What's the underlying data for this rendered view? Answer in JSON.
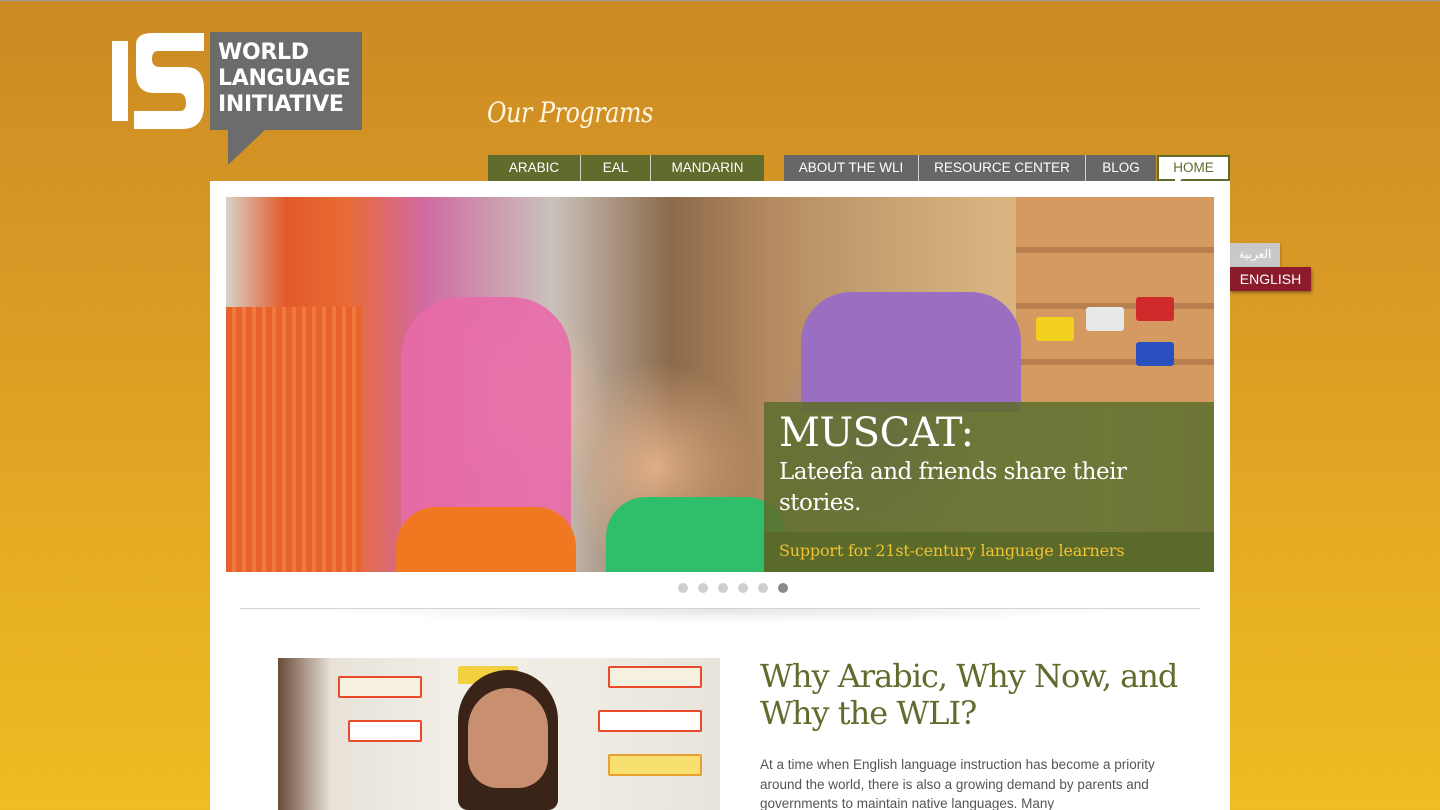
{
  "logo": {
    "lines": [
      "WORLD",
      "LANGUAGE",
      "INITIATIVE"
    ]
  },
  "programs_title": "Our Programs",
  "nav": {
    "programs": [
      "ARABIC",
      "EAL",
      "MANDARIN"
    ],
    "site": [
      "ABOUT THE WLI",
      "RESOURCE CENTER",
      "BLOG"
    ],
    "home": "HOME"
  },
  "lang": {
    "arabic": "العربية",
    "english": "ENGLISH"
  },
  "hero": {
    "title": "MUSCAT:",
    "subtitle": "Lateefa and friends share their stories.",
    "tagline": "Support for 21st-century language learners",
    "slide_count": 6,
    "active_slide": 6
  },
  "feature": {
    "title": "Why Arabic, Why Now, and Why the WLI?",
    "body": "At a time when English language instruction has become a priority around the world, there is also a growing demand by parents and governments to maintain native languages. Many"
  },
  "colors": {
    "accent_green": "#5f6c2c",
    "nav_gray": "#676767",
    "english_button": "#8b1a2a",
    "tagline_gold": "#f2c230",
    "background_gold": "#e0a524"
  },
  "icons": [
    "logo-mark-icon",
    "home-pointer-icon"
  ]
}
